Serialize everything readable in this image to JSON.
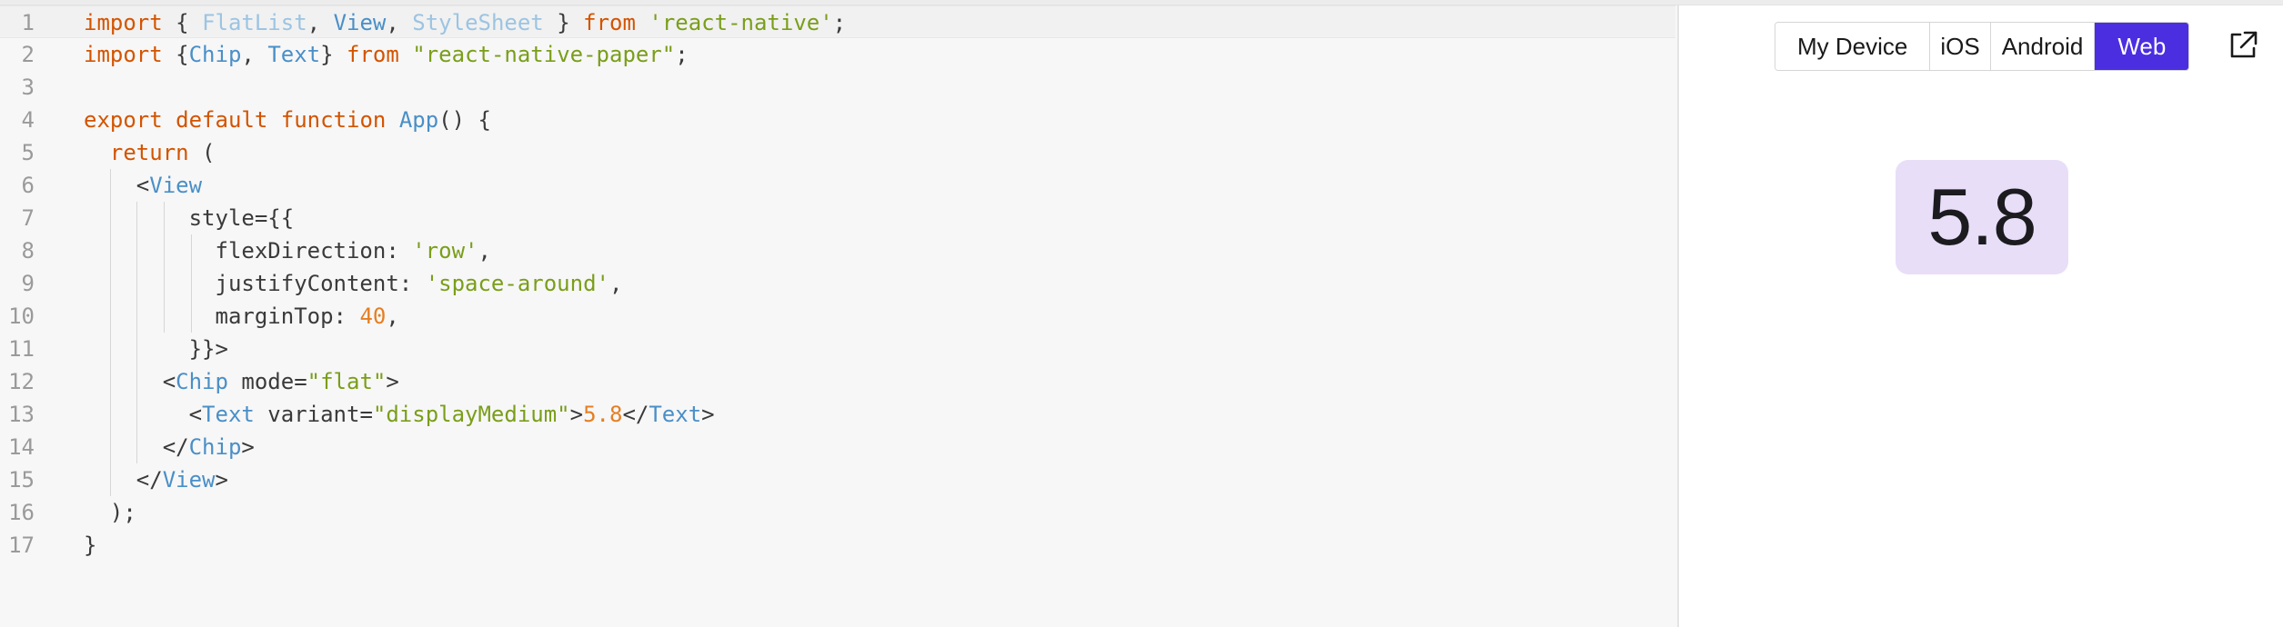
{
  "editor": {
    "lines": [
      {
        "num": "1",
        "tokens": [
          {
            "t": "import",
            "c": "kw"
          },
          {
            "t": " { ",
            "c": "plain"
          },
          {
            "t": "FlatList",
            "c": "faded"
          },
          {
            "t": ", ",
            "c": "plain"
          },
          {
            "t": "View",
            "c": "ident"
          },
          {
            "t": ", ",
            "c": "plain"
          },
          {
            "t": "StyleSheet",
            "c": "faded"
          },
          {
            "t": " } ",
            "c": "plain"
          },
          {
            "t": "from",
            "c": "kw"
          },
          {
            "t": " ",
            "c": "plain"
          },
          {
            "t": "'react-native'",
            "c": "str"
          },
          {
            "t": ";",
            "c": "plain"
          }
        ]
      },
      {
        "num": "2",
        "tokens": [
          {
            "t": "import",
            "c": "kw"
          },
          {
            "t": " {",
            "c": "plain"
          },
          {
            "t": "Chip",
            "c": "ident"
          },
          {
            "t": ", ",
            "c": "plain"
          },
          {
            "t": "Text",
            "c": "ident"
          },
          {
            "t": "} ",
            "c": "plain"
          },
          {
            "t": "from",
            "c": "kw"
          },
          {
            "t": " ",
            "c": "plain"
          },
          {
            "t": "\"react-native-paper\"",
            "c": "str"
          },
          {
            "t": ";",
            "c": "plain"
          }
        ]
      },
      {
        "num": "3",
        "tokens": []
      },
      {
        "num": "4",
        "tokens": [
          {
            "t": "export",
            "c": "kw"
          },
          {
            "t": " ",
            "c": "plain"
          },
          {
            "t": "default",
            "c": "kw"
          },
          {
            "t": " ",
            "c": "plain"
          },
          {
            "t": "function",
            "c": "kw"
          },
          {
            "t": " ",
            "c": "plain"
          },
          {
            "t": "App",
            "c": "ident"
          },
          {
            "t": "() {",
            "c": "plain"
          }
        ]
      },
      {
        "num": "5",
        "tokens": [
          {
            "t": "  ",
            "c": "plain"
          },
          {
            "t": "return",
            "c": "kw"
          },
          {
            "t": " (",
            "c": "plain"
          }
        ]
      },
      {
        "num": "6",
        "tokens": [
          {
            "t": "    <",
            "c": "plain"
          },
          {
            "t": "View",
            "c": "ident"
          }
        ]
      },
      {
        "num": "7",
        "tokens": [
          {
            "t": "        style={{",
            "c": "plain"
          }
        ]
      },
      {
        "num": "8",
        "tokens": [
          {
            "t": "          flexDirection: ",
            "c": "plain"
          },
          {
            "t": "'row'",
            "c": "str"
          },
          {
            "t": ",",
            "c": "plain"
          }
        ]
      },
      {
        "num": "9",
        "tokens": [
          {
            "t": "          justifyContent: ",
            "c": "plain"
          },
          {
            "t": "'space-around'",
            "c": "str"
          },
          {
            "t": ",",
            "c": "plain"
          }
        ]
      },
      {
        "num": "10",
        "tokens": [
          {
            "t": "          marginTop: ",
            "c": "plain"
          },
          {
            "t": "40",
            "c": "num"
          },
          {
            "t": ",",
            "c": "plain"
          }
        ]
      },
      {
        "num": "11",
        "tokens": [
          {
            "t": "        }}>",
            "c": "plain"
          }
        ]
      },
      {
        "num": "12",
        "tokens": [
          {
            "t": "      <",
            "c": "plain"
          },
          {
            "t": "Chip",
            "c": "ident"
          },
          {
            "t": " mode=",
            "c": "plain"
          },
          {
            "t": "\"flat\"",
            "c": "str"
          },
          {
            "t": ">",
            "c": "plain"
          }
        ]
      },
      {
        "num": "13",
        "tokens": [
          {
            "t": "        <",
            "c": "plain"
          },
          {
            "t": "Text",
            "c": "ident"
          },
          {
            "t": " variant=",
            "c": "plain"
          },
          {
            "t": "\"displayMedium\"",
            "c": "str"
          },
          {
            "t": ">",
            "c": "plain"
          },
          {
            "t": "5.8",
            "c": "num"
          },
          {
            "t": "</",
            "c": "plain"
          },
          {
            "t": "Text",
            "c": "ident"
          },
          {
            "t": ">",
            "c": "plain"
          }
        ]
      },
      {
        "num": "14",
        "tokens": [
          {
            "t": "      </",
            "c": "plain"
          },
          {
            "t": "Chip",
            "c": "ident"
          },
          {
            "t": ">",
            "c": "plain"
          }
        ]
      },
      {
        "num": "15",
        "tokens": [
          {
            "t": "    </",
            "c": "plain"
          },
          {
            "t": "View",
            "c": "ident"
          },
          {
            "t": ">",
            "c": "plain"
          }
        ]
      },
      {
        "num": "16",
        "tokens": [
          {
            "t": "  );",
            "c": "plain"
          }
        ]
      },
      {
        "num": "17",
        "tokens": [
          {
            "t": "}",
            "c": "plain"
          }
        ]
      }
    ]
  },
  "preview": {
    "platform_tabs": [
      {
        "label": "My Device",
        "key": "my-device",
        "selected": false
      },
      {
        "label": "iOS",
        "key": "ios",
        "selected": false
      },
      {
        "label": "Android",
        "key": "android",
        "selected": false
      },
      {
        "label": "Web",
        "key": "web",
        "selected": true
      }
    ],
    "popout_icon": "external-link-icon",
    "chip_text": "5.8"
  },
  "colors": {
    "accent": "#4a2ee0",
    "chip_bg": "#e8def8",
    "keyword": "#d35400",
    "string": "#7a9e1a",
    "number": "#e67e22",
    "identifier": "#4a8fc7"
  }
}
